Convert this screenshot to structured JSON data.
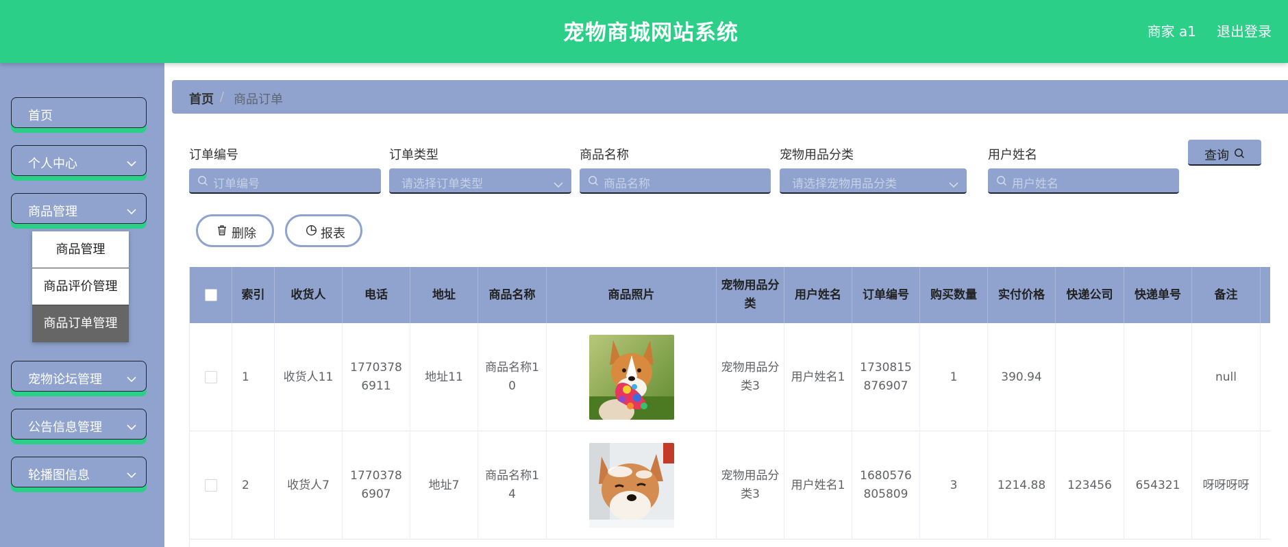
{
  "header": {
    "title": "宠物商城网站系统",
    "user": "商家 a1",
    "logout": "退出登录"
  },
  "sidebar": {
    "items": [
      {
        "label": "首页"
      },
      {
        "label": "个人中心"
      },
      {
        "label": "商品管理"
      },
      {
        "label": "宠物论坛管理"
      },
      {
        "label": "公告信息管理"
      },
      {
        "label": "轮播图信息"
      }
    ],
    "submenu": [
      {
        "label": "商品管理"
      },
      {
        "label": "商品评价管理"
      },
      {
        "label": "商品订单管理"
      }
    ]
  },
  "breadcrumb": {
    "home": "首页",
    "separator": "/",
    "current": "商品订单"
  },
  "search": {
    "fields": [
      {
        "label": "订单编号",
        "placeholder": "订单编号"
      },
      {
        "label": "订单类型",
        "placeholder": "请选择订单类型"
      },
      {
        "label": "商品名称",
        "placeholder": "商品名称"
      },
      {
        "label": "宠物用品分类",
        "placeholder": "请选择宠物用品分类"
      },
      {
        "label": "用户姓名",
        "placeholder": "用户姓名"
      }
    ],
    "query_label": "查询"
  },
  "actions": {
    "delete_label": "删除",
    "report_label": "报表"
  },
  "table": {
    "headers": [
      "索引",
      "收货人",
      "电话",
      "地址",
      "商品名称",
      "商品照片",
      "宠物用品分类",
      "用户姓名",
      "订单编号",
      "购买数量",
      "实付价格",
      "快递公司",
      "快递单号",
      "备注"
    ],
    "rows": [
      {
        "index": "1",
        "receiver": "收货人11",
        "phone": "17703786911",
        "address": "地址11",
        "product": "商品名称10",
        "photo": "corgi-with-toy",
        "category": "宠物用品分类3",
        "user": "用户姓名1",
        "order_no": "1730815876907",
        "qty": "1",
        "price": "390.94",
        "courier": "",
        "tracking": "",
        "remark": "null"
      },
      {
        "index": "2",
        "receiver": "收货人7",
        "phone": "17703786907",
        "address": "地址7",
        "product": "商品名称14",
        "photo": "shiba-in-snow",
        "category": "宠物用品分类3",
        "user": "用户姓名1",
        "order_no": "1680576805809",
        "qty": "3",
        "price": "1214.88",
        "courier": "123456",
        "tracking": "654321",
        "remark": "呀呀呀呀"
      }
    ]
  },
  "colors": {
    "header": "#2bcf88",
    "sidebar": "#8fa3ce",
    "accent": "#2bcf88"
  }
}
